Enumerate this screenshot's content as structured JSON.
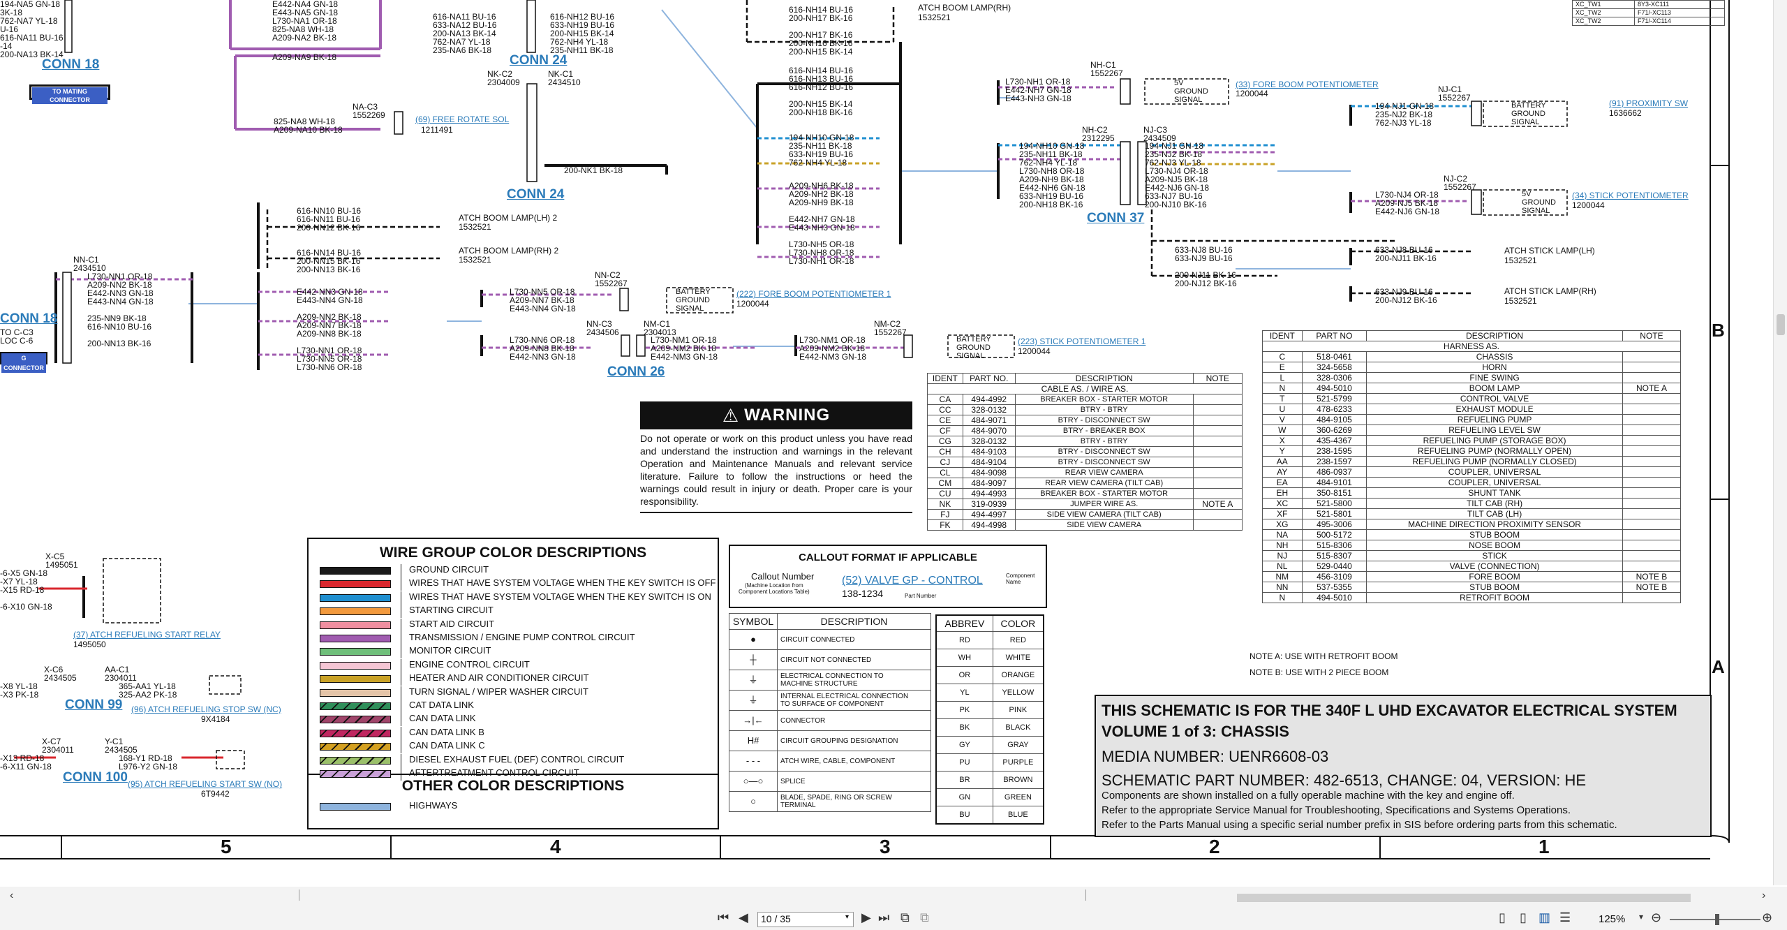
{
  "connectors": {
    "conn18_top": "CONN 18",
    "conn18_mid": "CONN 18",
    "conn24_top": "CONN 24",
    "conn24": "CONN 24",
    "conn37": "CONN 37",
    "conn26": "CONN 26",
    "conn99": "CONN 99",
    "conn100": "CONN 100",
    "to_mating": "TO MATING CONNECTOR",
    "connector_btn": "G CONNECTOR"
  },
  "components": {
    "free_rotate": "(69) FREE ROTATE SOL",
    "free_rotate_pn": "1211491",
    "fore_boom_pot": "(33) FORE BOOM POTENTIOMETER",
    "fore_boom_pot_pn": "1200044",
    "prox_sw": "(91) PROXIMITY SW",
    "prox_sw_pn": "1636662",
    "stick_pot": "(34) STICK POTENTIOMETER",
    "stick_pot_pn": "1200044",
    "fore_boom_pot1": "(222) FORE BOOM POTENTIOMETER 1",
    "fore_boom_pot1_pn": "1200044",
    "stick_pot1": "(223) STICK POTENTIOMETER 1",
    "stick_pot1_pn": "1200044",
    "refuel_start_relay": "(37) ATCH REFUELING START RELAY",
    "refuel_start_relay_pn": "1495050",
    "refuel_stop_sw": "(96) ATCH REFUELING STOP SW (NC)",
    "refuel_stop_sw_pn": "9X4184",
    "refuel_start_sw": "(95) ATCH REFUELING START SW (NO)",
    "refuel_start_sw_pn": "6T9442",
    "boom_lamp_rh_top": "ATCH BOOM LAMP(RH)",
    "boom_lamp_rh_top_pn": "1532521",
    "boom_lamp_lh2": "ATCH BOOM LAMP(LH) 2",
    "boom_lamp_lh2_pn": "1532521",
    "boom_lamp_rh2": "ATCH BOOM LAMP(RH) 2",
    "boom_lamp_rh2_pn": "1532521",
    "stick_lamp_lh": "ATCH STICK LAMP(LH)",
    "stick_lamp_lh_pn": "1532521",
    "stick_lamp_rh": "ATCH STICK LAMP(RH)",
    "stick_lamp_rh_pn": "1532521",
    "battery_sig": "BATTERY\nGROUND\nSIGNAL",
    "fivev_sig": "5V\nGROUND\nSIGNAL",
    "prox_sig": "BATTERY\nGROUND\nSIGNAL"
  },
  "wires": {
    "topleft_a": "194-NA5 GN-18\n3K-18\n762-NA7 YL-18\nU-16\n616-NA11 BU-16\n-14\n200-NA13 BK-14",
    "topleft_b": "E442-NA4 GN-18\nE443-NA5 GN-18\nL730-NA1 OR-18\n825-NA8 WH-18\nA209-NA2 BK-18",
    "topleft_c": "616-NA11 BU-16\n633-NA12 BU-16\n200-NA13 BK-14\n762-NA7 YL-18\n235-NA6 BK-18",
    "topleft_d": "616-NH12 BU-16\n633-NH19 BU-16\n200-NH15 BK-14\n762-NH4 YL-18\n235-NH11 BK-18",
    "na9": "A209-NA9 BK-18",
    "na_sol": "825-NA8 WH-18\nA209-NA10 BK-18",
    "nac3": "NA-C3\n1552269",
    "nkc2": "NK-C2\n2304009",
    "nkc1": "NK-C1\n2434510",
    "nk1": "200-NK1 BK-18",
    "nh_top": "616-NH14 BU-16\n200-NH17 BK-16\n\n200-NH17 BK-16\n200-NH16 BK-16\n200-NH15 BK-14",
    "nh_mid": "616-NH14 BU-16\n616-NH13 BU-16\n616-NH12 BU-16\n\n200-NH15 BK-14\n200-NH18 BK-16",
    "nh_mid2": "194-NH10 GN-18\n235-NH11 BK-18\n633-NH19 BU-16\n762-NH4 YL-18",
    "nh_mid3": "A209-NH6 BK-18\nA209-NH2 BK-18\nA209-NH9 BK-18\n\nE442-NH7 GN-18\nE443-NH3 GN-18\n\nL730-NH5 OR-18\nL730-NH8 OR-18\nL730-NH1 OR-18",
    "nhc1": "NH-C1\n1552267",
    "nhc1_w": "L730-NH1 OR-18\nE442-NH7 GN-18\nE443-NH3 GN-18",
    "nhc2": "NH-C2\n2312295",
    "njc3": "NJ-C3\n2434509",
    "nhc2_w": "194-NH10 GN-18\n235-NH11 BK-18\n762-NH4 YL-18\nL730-NH8 OR-18\nA209-NH9 BK-18\nE442-NH6 GN-18\n633-NH19 BU-16\n200-NH18 BK-16",
    "njc3_w": "194-NJ1 GN-18\n235-NJ2 BK-18\n762-NJ3 YL-18\nL730-NJ4 OR-18\nA209-NJ5 BK-18\nE442-NJ6 GN-18\n633-NJ7 BU-16\n200-NJ10 BK-16",
    "njc1": "NJ-C1\n1552267",
    "njc1_w": "194-NJ1 GN-18\n235-NJ2 BK-18\n762-NJ3 YL-18",
    "njc2": "NJ-C2\n1552267",
    "njc2_w": "L730-NJ4 OR-18\nA209-NJ5 BK-18\nE442-NJ6 GN-18",
    "nj_lamp1": "633-NJ8 BU-16\n633-NJ9 BU-16\n\n200-NJ11 BK-16\n200-NJ12 BK-16",
    "nj_lamp_r1": "633-NJ8 BU-16\n200-NJ11 BK-16",
    "nj_lamp_r2": "633-NJ9 BU-16\n200-NJ12 BK-16",
    "nn_lamps": "616-NN10 BU-16\n616-NN11 BU-16\n200-NN12 BK-16\n\n\n616-NN14 BU-16\n200-NN15 BK-16\n200-NN13 BK-16",
    "nnc1": "NN-C1\n2434510",
    "nnc1_w": "L730-NN1 OR-18\nA209-NN2 BK-18\nE442-NN3 GN-18\nE443-NN4 GN-18\n\n235-NN9 BK-18\n616-NN10 BU-16\n\n200-NN13 BK-16",
    "nn_mid": "E442-NN3 GN-18\nE443-NN4 GN-18\n\nA209-NN2 BK-18\nA209-NN7 BK-18\nA209-NN8 BK-18\n\nL730-NN1 OR-18\nL730-NN5 OR-18\nL730-NN6 OR-18",
    "nnc2": "NN-C2\n1552267",
    "nnc2_w": "L730-NN5 OR-18\nA209-NN7 BK-18\nE443-NN4 GN-18",
    "nnc3": "NN-C3\n2434506",
    "nmc1": "NM-C1\n2304013",
    "nnc3_w": "L730-NN6 OR-18\nA209-NN8 BK-18\nE442-NN3 GN-18",
    "nmc1_w": "L730-NM1 OR-18\nA209-NM2 BK-18\nE442-NM3 GN-18",
    "nmc2": "NM-C2\n1552267",
    "nmc2_w": "L730-NM1 OR-18\nA209-NM2 BK-18\nE442-NM3 GN-18",
    "left_clip": "TO C-C3\nLOC C-6",
    "xc5": "X-C5\n1495051",
    "xc5_w": "-6-X5 GN-18\n-X7 YL-18\n-X15 RD-18\n\n-6-X10 GN-18",
    "xc6": "X-C6\n2434505",
    "aac1": "AA-C1\n2304011",
    "xc6_w": "-X8 YL-18\n-X3 PK-18",
    "aac1_w": "365-AA1 YL-18\n325-AA2 PK-18",
    "xc7": "X-C7\n2304011",
    "yc1": "Y-C1\n2434505",
    "xc7_w": "-X13 RD-18\n-6-X11 GN-18",
    "yc1_w": "168-Y1 RD-18\nL976-Y2 GN-18"
  },
  "cable_table": {
    "headers": [
      "IDENT",
      "PART NO.",
      "DESCRIPTION",
      "NOTE"
    ],
    "title": "CABLE AS. / WIRE AS.",
    "rows": [
      [
        "CA",
        "494-4992",
        "BREAKER BOX - STARTER MOTOR",
        ""
      ],
      [
        "CC",
        "328-0132",
        "BTRY - BTRY",
        ""
      ],
      [
        "CE",
        "484-9071",
        "BTRY - DISCONNECT SW",
        ""
      ],
      [
        "CF",
        "484-9070",
        "BTRY - BREAKER BOX",
        ""
      ],
      [
        "CG",
        "328-0132",
        "BTRY - BTRY",
        ""
      ],
      [
        "CH",
        "484-9103",
        "BTRY - DISCONNECT SW",
        ""
      ],
      [
        "CJ",
        "484-9104",
        "BTRY - DISCONNECT SW",
        ""
      ],
      [
        "CL",
        "484-9098",
        "REAR VIEW CAMERA",
        ""
      ],
      [
        "CM",
        "484-9097",
        "REAR VIEW CAMERA (TILT CAB)",
        ""
      ],
      [
        "CU",
        "494-4993",
        "BREAKER BOX - STARTER MOTOR",
        ""
      ],
      [
        "NK",
        "319-0939",
        "JUMPER WIRE AS.",
        "NOTE A"
      ],
      [
        "FJ",
        "494-4997",
        "SIDE VIEW CAMERA (TILT CAB)",
        ""
      ],
      [
        "FK",
        "494-4998",
        "SIDE VIEW CAMERA",
        ""
      ]
    ]
  },
  "harness_table": {
    "headers": [
      "IDENT",
      "PART NO",
      "DESCRIPTION",
      "NOTE"
    ],
    "title": "HARNESS AS.",
    "rows": [
      [
        "C",
        "518-0461",
        "CHASSIS",
        ""
      ],
      [
        "E",
        "324-5658",
        "HORN",
        ""
      ],
      [
        "L",
        "328-0306",
        "FINE SWING",
        ""
      ],
      [
        "N",
        "494-5010",
        "BOOM LAMP",
        "NOTE A"
      ],
      [
        "T",
        "521-5799",
        "CONTROL VALVE",
        ""
      ],
      [
        "U",
        "478-6233",
        "EXHAUST MODULE",
        ""
      ],
      [
        "V",
        "484-9105",
        "REFUELING PUMP",
        ""
      ],
      [
        "W",
        "360-6269",
        "REFUELING LEVEL SW",
        ""
      ],
      [
        "X",
        "435-4367",
        "REFUELING PUMP (STORAGE BOX)",
        ""
      ],
      [
        "Y",
        "238-1595",
        "REFUELING PUMP (NORMALLY OPEN)",
        ""
      ],
      [
        "AA",
        "238-1597",
        "REFUELING PUMP (NORMALLY CLOSED)",
        ""
      ],
      [
        "AY",
        "486-0937",
        "COUPLER, UNIVERSAL",
        ""
      ],
      [
        "EA",
        "484-9101",
        "COUPLER, UNIVERSAL",
        ""
      ],
      [
        "EH",
        "350-8151",
        "SHUNT TANK",
        ""
      ],
      [
        "XC",
        "521-5800",
        "TILT CAB (RH)",
        ""
      ],
      [
        "XF",
        "521-5801",
        "TILT CAB (LH)",
        ""
      ],
      [
        "XG",
        "495-3006",
        "MACHINE DIRECTION PROXIMITY SENSOR",
        ""
      ],
      [
        "NA",
        "500-5172",
        "STUB BOOM",
        ""
      ],
      [
        "NH",
        "515-8306",
        "NOSE BOOM",
        ""
      ],
      [
        "NJ",
        "515-8307",
        "STICK",
        ""
      ],
      [
        "NL",
        "529-0440",
        "VALVE (CONNECTION)",
        ""
      ],
      [
        "NM",
        "456-3109",
        "FORE BOOM",
        "NOTE B"
      ],
      [
        "NN",
        "537-5355",
        "STUB BOOM",
        "NOTE B"
      ],
      [
        "N",
        "494-5010",
        "RETROFIT BOOM",
        ""
      ]
    ]
  },
  "top_right_table": {
    "rows": [
      [
        "XC_TW1",
        "8Y3-XC111"
      ],
      [
        "XC_TW2",
        "F71/-XC113"
      ],
      [
        "XC_TW2",
        "F71/-XC114"
      ]
    ]
  },
  "notes": {
    "note_a": "NOTE A: USE WITH RETROFIT BOOM",
    "note_b": "NOTE B: USE WITH 2 PIECE BOOM"
  },
  "warning": {
    "title": "WARNING",
    "text": "Do not operate or work on this product unless you have read and understand the instruction and warnings in the relevant Operation and Maintenance Manuals and relevant service literature. Failure to follow the instructions or heed the warnings could result in injury or death. Proper care is your responsibility."
  },
  "legend": {
    "title": "WIRE GROUP COLOR DESCRIPTIONS",
    "items": [
      {
        "label": "GROUND CIRCUIT",
        "color": "#1a1a1a",
        "pattern": "solid"
      },
      {
        "label": "WIRES THAT HAVE SYSTEM VOLTAGE WHEN THE KEY SWITCH IS OFF",
        "color": "#d9272e",
        "pattern": "solid"
      },
      {
        "label": "WIRES THAT HAVE SYSTEM VOLTAGE WHEN THE KEY SWITCH IS ON",
        "color": "#1f8fd0",
        "pattern": "solid"
      },
      {
        "label": "STARTING CIRCUIT",
        "color": "#f39a3d",
        "pattern": "solid"
      },
      {
        "label": "START AID CIRCUIT",
        "color": "#ef8fa0",
        "pattern": "solid"
      },
      {
        "label": "TRANSMISSION / ENGINE PUMP CONTROL CIRCUIT",
        "color": "#a05cb0",
        "pattern": "solid"
      },
      {
        "label": "MONITOR CIRCUIT",
        "color": "#6fbf7a",
        "pattern": "solid"
      },
      {
        "label": "ENGINE CONTROL CIRCUIT",
        "color": "#f5c6d4",
        "pattern": "solid"
      },
      {
        "label": "HEATER AND AIR CONDITIONER CIRCUIT",
        "color": "#c9a227",
        "pattern": "solid"
      },
      {
        "label": "TURN SIGNAL / WIPER WASHER CIRCUIT",
        "color": "#e4c4a8",
        "pattern": "solid"
      },
      {
        "label": "CAT DATA LINK",
        "color": "#2f8f5a",
        "pattern": "stripe"
      },
      {
        "label": "CAN DATA LINK",
        "color": "#a0456a",
        "pattern": "stripe"
      },
      {
        "label": "CAN DATA LINK B",
        "color": "#c02660",
        "pattern": "stripe"
      },
      {
        "label": "CAN DATA LINK C",
        "color": "#d4a020",
        "pattern": "stripe"
      },
      {
        "label": "DIESEL EXHAUST FUEL (DEF) CONTROL CIRCUIT",
        "color": "#9ac06a",
        "pattern": "stripe"
      },
      {
        "label": "AFTERTREATMENT CONTROL CIRCUIT",
        "color": "#c9a0d8",
        "pattern": "stripe"
      }
    ],
    "other_title": "OTHER COLOR DESCRIPTIONS",
    "other_items": [
      {
        "label": "HIGHWAYS",
        "color": "#8eb4de",
        "pattern": "solid"
      }
    ]
  },
  "callout": {
    "title": "CALLOUT FORMAT IF APPLICABLE",
    "callout_number": "Callout Number",
    "callout_sub": "(Machine Location from\nComponent Locations Table)",
    "example_link": "(52) VALVE GP - CONTROL",
    "component_name": "Component\nName",
    "part_no": "138-1234",
    "part_no_label": "Part Number"
  },
  "symbol_table": {
    "headers": [
      "SYMBOL",
      "DESCRIPTION"
    ],
    "rows": [
      {
        "sym": "●",
        "desc": "CIRCUIT CONNECTED"
      },
      {
        "sym": "┼",
        "desc": "CIRCUIT NOT CONNECTED"
      },
      {
        "sym": "⏚",
        "desc": "ELECTRICAL CONNECTION TO\nMACHINE STRUCTURE"
      },
      {
        "sym": "⏚",
        "desc": "INTERNAL ELECTRICAL CONNECTION\nTO SURFACE OF COMPONENT"
      },
      {
        "sym": "→|←",
        "desc": "CONNECTOR"
      },
      {
        "sym": "H#",
        "desc": "CIRCUIT GROUPING DESIGNATION"
      },
      {
        "sym": "- - -",
        "desc": "ATCH WIRE, CABLE, COMPONENT"
      },
      {
        "sym": "○—○",
        "desc": "SPLICE"
      },
      {
        "sym": "○",
        "desc": "BLADE, SPADE, RING OR SCREW\nTERMINAL"
      }
    ]
  },
  "abbrev_table": {
    "headers": [
      "ABBREV",
      "COLOR"
    ],
    "rows": [
      [
        "RD",
        "RED"
      ],
      [
        "WH",
        "WHITE"
      ],
      [
        "OR",
        "ORANGE"
      ],
      [
        "YL",
        "YELLOW"
      ],
      [
        "PK",
        "PINK"
      ],
      [
        "BK",
        "BLACK"
      ],
      [
        "GY",
        "GRAY"
      ],
      [
        "PU",
        "PURPLE"
      ],
      [
        "BR",
        "BROWN"
      ],
      [
        "GN",
        "GREEN"
      ],
      [
        "BU",
        "BLUE"
      ]
    ]
  },
  "title_block": {
    "line1": "THIS SCHEMATIC IS FOR THE 340F L UHD EXCAVATOR ELECTRICAL SYSTEM",
    "line2": "VOLUME 1 of 3: CHASSIS",
    "line3": "MEDIA NUMBER: UENR6608-03",
    "line4": "SCHEMATIC PART NUMBER: 482-6513, CHANGE: 04, VERSION: HE",
    "line5": "Components are shown installed on a fully operable machine with the key and engine off.",
    "line6": "Refer to the appropriate Service Manual for Troubleshooting, Specifications and Systems Operations.",
    "line7": "Refer to the Parts Manual using a specific serial number prefix in SIS before ordering parts from this schematic."
  },
  "zones": {
    "cols": [
      "5",
      "4",
      "3",
      "2",
      "1"
    ],
    "rows": [
      "B",
      "A"
    ]
  },
  "viewer": {
    "page_value": "10 / 35",
    "zoom": "125%",
    "zoom_fraction": 0.52
  }
}
